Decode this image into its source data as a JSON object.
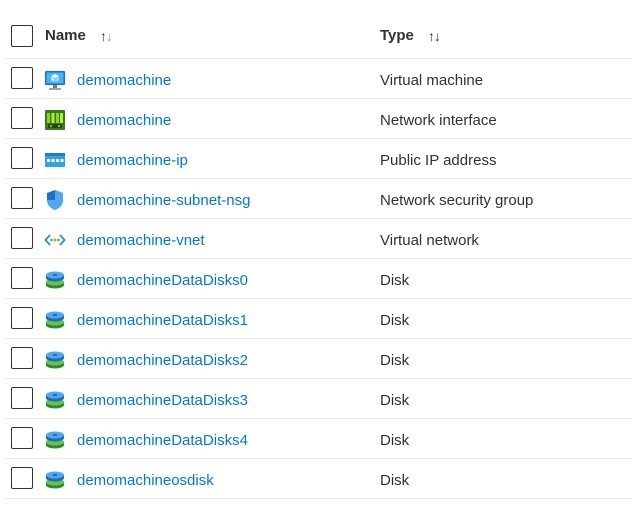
{
  "header": {
    "name_label": "Name",
    "type_label": "Type",
    "name_sort_icon": "sort-arrows-icon",
    "type_sort_icon": "sort-arrows-icon"
  },
  "rows": [
    {
      "name": "demomachine",
      "type": "Virtual machine",
      "icon": "virtual-machine-icon"
    },
    {
      "name": "demomachine",
      "type": "Network interface",
      "icon": "network-interface-icon"
    },
    {
      "name": "demomachine-ip",
      "type": "Public IP address",
      "icon": "public-ip-icon"
    },
    {
      "name": "demomachine-subnet-nsg",
      "type": "Network security group",
      "icon": "shield-icon"
    },
    {
      "name": "demomachine-vnet",
      "type": "Virtual network",
      "icon": "virtual-network-icon"
    },
    {
      "name": "demomachineDataDisks0",
      "type": "Disk",
      "icon": "disk-icon"
    },
    {
      "name": "demomachineDataDisks1",
      "type": "Disk",
      "icon": "disk-icon"
    },
    {
      "name": "demomachineDataDisks2",
      "type": "Disk",
      "icon": "disk-icon"
    },
    {
      "name": "demomachineDataDisks3",
      "type": "Disk",
      "icon": "disk-icon"
    },
    {
      "name": "demomachineDataDisks4",
      "type": "Disk",
      "icon": "disk-icon"
    },
    {
      "name": "demomachineosdisk",
      "type": "Disk",
      "icon": "disk-icon"
    }
  ],
  "colors": {
    "link": "#0078d4",
    "text": "#323130",
    "divider": "#edebe9"
  }
}
